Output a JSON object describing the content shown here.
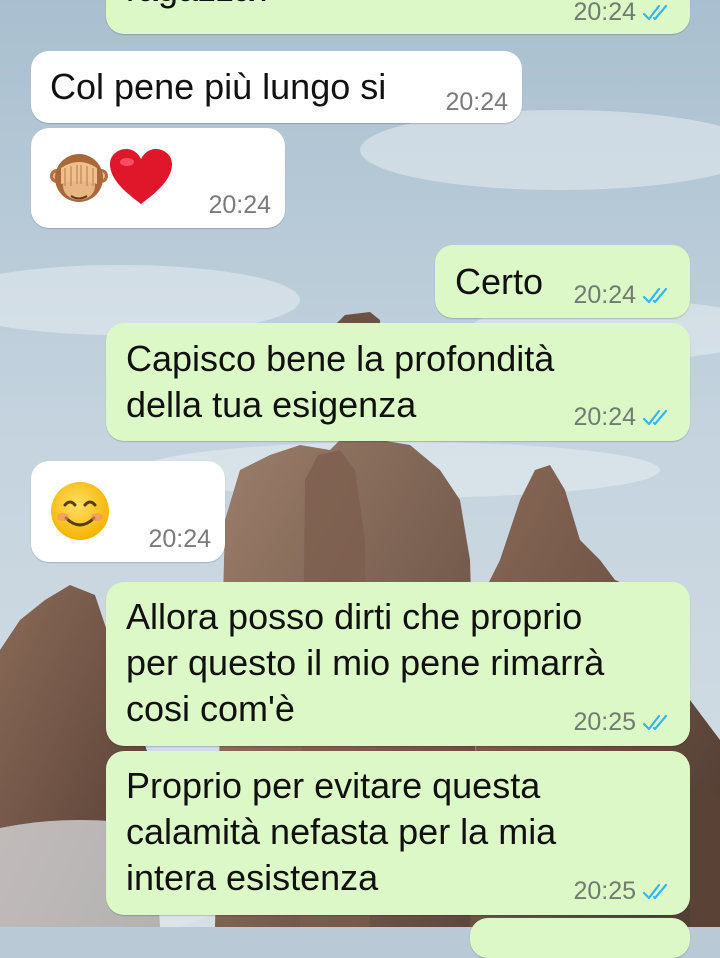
{
  "colors": {
    "outgoing_bubble": "#dcf8c6",
    "incoming_bubble": "#ffffff",
    "read_ticks": "#34b7f1",
    "timestamp": "#6f7c70"
  },
  "messages": [
    {
      "direction": "out",
      "text": "ragazza?",
      "time": "20:24",
      "status": "read"
    },
    {
      "direction": "in",
      "text": "Col pene più lungo si",
      "time": "20:24"
    },
    {
      "direction": "in",
      "emoji": [
        "see-no-evil-monkey",
        "red-heart"
      ],
      "time": "20:24"
    },
    {
      "direction": "out",
      "text": "Certo",
      "time": "20:24",
      "status": "read"
    },
    {
      "direction": "out",
      "lines": [
        "Capisco bene la profondità",
        "della tua esigenza"
      ],
      "time": "20:24",
      "status": "read"
    },
    {
      "direction": "in",
      "emoji": [
        "smiling-face-with-smiling-eyes"
      ],
      "time": "20:24"
    },
    {
      "direction": "out",
      "lines": [
        "Allora posso dirti che proprio",
        "per questo il mio pene rimarrà",
        "cosi com'è"
      ],
      "time": "20:25",
      "status": "read"
    },
    {
      "direction": "out",
      "lines": [
        "Proprio per evitare questa",
        "calamità nefasta per la mia",
        "intera esistenza"
      ],
      "time": "20:25",
      "status": "read"
    }
  ]
}
